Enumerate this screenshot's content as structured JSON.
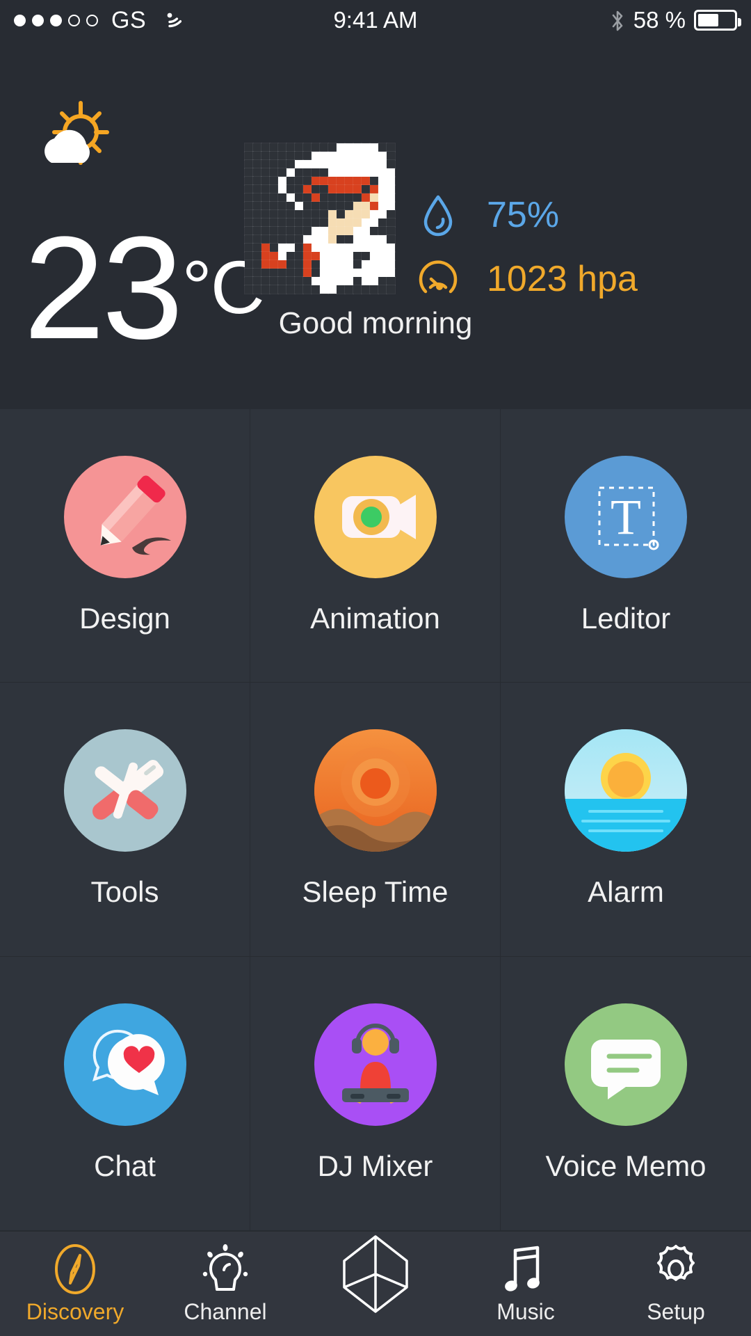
{
  "status_bar": {
    "signal_dots_filled": 3,
    "signal_dots_total": 5,
    "carrier": "GS",
    "wifi_icon": "wifi-icon",
    "time": "9:41 AM",
    "bluetooth_icon": "bluetooth-icon",
    "battery_percent": "58 %",
    "battery_level": 58
  },
  "weather": {
    "condition_icon": "sun-behind-cloud-icon",
    "temperature": "23",
    "unit": "°C",
    "greeting": "Good morning",
    "avatar_icon": "pixel-art-avatar",
    "metrics": [
      {
        "icon": "water-drop-icon",
        "value": "75%",
        "color": "#5ba7e8",
        "name": "humidity"
      },
      {
        "icon": "pressure-gauge-icon",
        "value": "1023 hpa",
        "color": "#f0a92b",
        "name": "pressure"
      }
    ]
  },
  "apps": [
    {
      "label": "Design",
      "icon": "pencil-icon",
      "bg": "#f59495"
    },
    {
      "label": "Animation",
      "icon": "video-camera-icon",
      "bg": "#f8c660"
    },
    {
      "label": "Leditor",
      "icon": "text-tool-icon",
      "bg": "#5b9bd5"
    },
    {
      "label": "Tools",
      "icon": "swiss-knife-icon",
      "bg": "#a9c6ce"
    },
    {
      "label": "Sleep Time",
      "icon": "sunset-dunes-icon",
      "bg": "#e8732a"
    },
    {
      "label": "Alarm",
      "icon": "sunrise-sea-icon",
      "bg": "#27c6f0"
    },
    {
      "label": "Chat",
      "icon": "speech-heart-icon",
      "bg": "#3fa6e0"
    },
    {
      "label": "DJ Mixer",
      "icon": "dj-person-icon",
      "bg": "#a94ff5"
    },
    {
      "label": "Voice Memo",
      "icon": "message-lines-icon",
      "bg": "#93c982"
    }
  ],
  "tabs": [
    {
      "label": "Discovery",
      "icon": "compass-icon",
      "active": true
    },
    {
      "label": "Channel",
      "icon": "lightbulb-icon",
      "active": false
    },
    {
      "label": "",
      "icon": "cube-icon",
      "active": false
    },
    {
      "label": "Music",
      "icon": "music-note-icon",
      "active": false
    },
    {
      "label": "Setup",
      "icon": "gear-icon",
      "active": false
    }
  ],
  "colors": {
    "background": "#2b2f36",
    "panel": "#282c33",
    "grid": "#2f343c",
    "divider": "#272b31",
    "accent": "#f0a92b",
    "text": "#f2f2f2"
  },
  "avatar_pixels": [
    "...........wwwww..",
    "........wwwwwwwww.",
    "......wwwwwwwwwww.",
    ".....w....wwwwwwww",
    "....w...rrrrrrr.ww",
    "....w..r.Brrrr.rww",
    ".....w..r..B..rsww",
    "......w...BB.ssrww",
    "..........sBsssww.",
    "..........ssssww..",
    "........wwsssww...",
    ".......wwws..wwww.",
    "..r.ww.rwwwwwwwwww",
    "..rrw..rrwwww..www",
    "..rrr..r.wwww.wwww",
    ".......r.wwwwwwwww",
    "........wwwww.ww..",
    ".........ww......."
  ]
}
